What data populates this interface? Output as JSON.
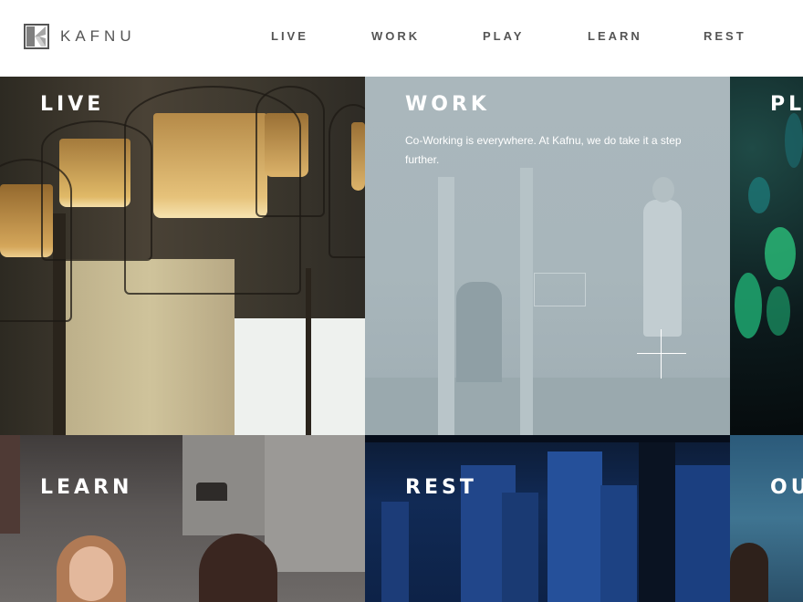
{
  "brand": {
    "name": "KAFNU",
    "logo_icon": "kafnu-logo-icon"
  },
  "nav": [
    {
      "label": "LIVE"
    },
    {
      "label": "WORK"
    },
    {
      "label": "PLAY"
    },
    {
      "label": "LEARN"
    },
    {
      "label": "REST"
    }
  ],
  "tiles": {
    "live": {
      "title": "LIVE"
    },
    "work": {
      "title": "WORK",
      "description": "Co-Working is everywhere. At Kafnu, we do take it a step further.",
      "expand_icon": "plus-icon"
    },
    "play": {
      "title": "PLA"
    },
    "learn": {
      "title": "LEARN"
    },
    "rest": {
      "title": "REST"
    },
    "ou": {
      "title": "OU"
    }
  },
  "colors": {
    "nav_text": "#555555",
    "work_overlay": "#a9b7bc",
    "tile_title": "#ffffff"
  }
}
